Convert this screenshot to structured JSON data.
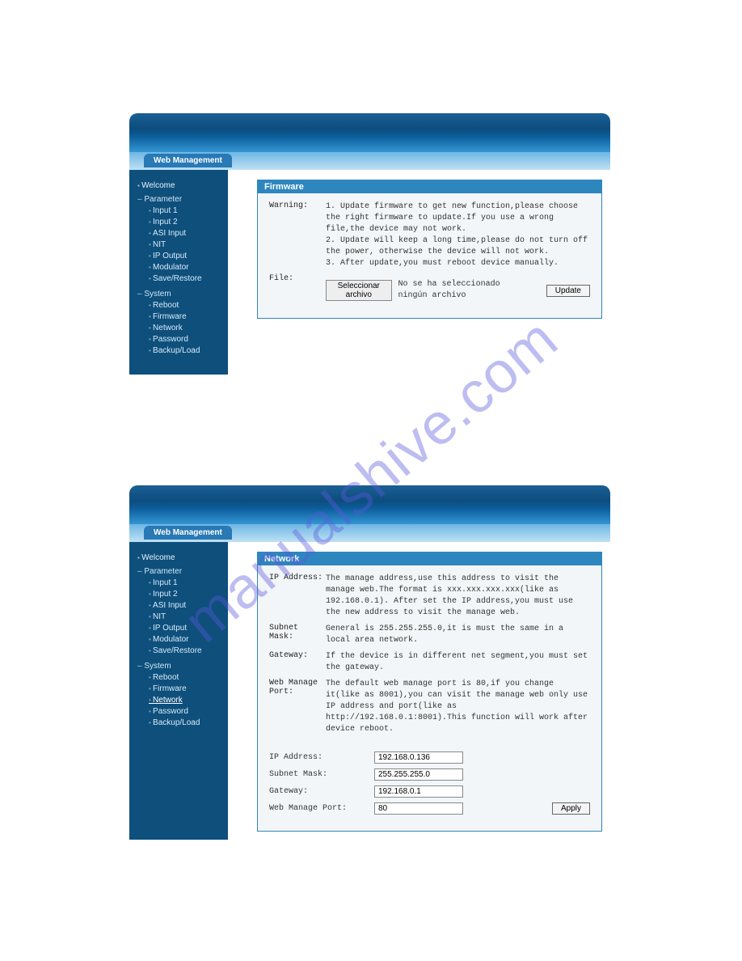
{
  "watermark": "manualshive.com",
  "panels": [
    {
      "tab": "Web Management",
      "sidebar": {
        "welcome": "Welcome",
        "groups": [
          {
            "label": "Parameter",
            "items": [
              "Input 1",
              "Input 2",
              "ASI Input",
              "NIT",
              "IP Output",
              "Modulator",
              "Save/Restore"
            ]
          },
          {
            "label": "System",
            "items": [
              "Reboot",
              "Firmware",
              "Network",
              "Password",
              "Backup/Load"
            ]
          }
        ]
      },
      "card": {
        "title": "Firmware",
        "warning_label": "Warning:",
        "warning_text": "1. Update firmware to get new function,please choose the right firmware to update.If you use a wrong file,the device may not work.\n2. Update will keep a long time,please do not turn off the power, otherwise the device will not work.\n3. After update,you must reboot device manually.",
        "file_label": "File:",
        "choose_btn": "Seleccionar archivo",
        "no_file": "No se ha seleccionado ningún archivo",
        "update_btn": "Update"
      }
    },
    {
      "tab": "Web Management",
      "sidebar": {
        "welcome": "Welcome",
        "groups": [
          {
            "label": "Parameter",
            "items": [
              "Input 1",
              "Input 2",
              "ASI Input",
              "NIT",
              "IP Output",
              "Modulator",
              "Save/Restore"
            ]
          },
          {
            "label": "System",
            "items": [
              "Reboot",
              "Firmware",
              "Network",
              "Password",
              "Backup/Load"
            ],
            "active": "Network"
          }
        ]
      },
      "card": {
        "title": "Network",
        "rows": [
          {
            "label": "IP Address:",
            "text": "The manage address,use this address to visit the manage web.The format is xxx.xxx.xxx.xxx(like as 192.168.0.1). After set the IP address,you must use the new address to visit the manage web."
          },
          {
            "label": "Subnet Mask:",
            "text": "General is 255.255.255.0,it is must the same in a local area network."
          },
          {
            "label": "Gateway:",
            "text": "If the device is in different net segment,you must set the gateway."
          },
          {
            "label": "Web Manage Port:",
            "text": "The default web manage port is 80,if you change it(like as 8001),you can visit the manage web only use IP address and port(like as http://192.168.0.1:8001).This function will work after device reboot."
          }
        ],
        "fields": [
          {
            "label": "IP Address:",
            "value": "192.168.0.136"
          },
          {
            "label": "Subnet Mask:",
            "value": "255.255.255.0"
          },
          {
            "label": "Gateway:",
            "value": "192.168.0.1"
          },
          {
            "label": "Web Manage Port:",
            "value": "80"
          }
        ],
        "apply_btn": "Apply"
      }
    }
  ]
}
